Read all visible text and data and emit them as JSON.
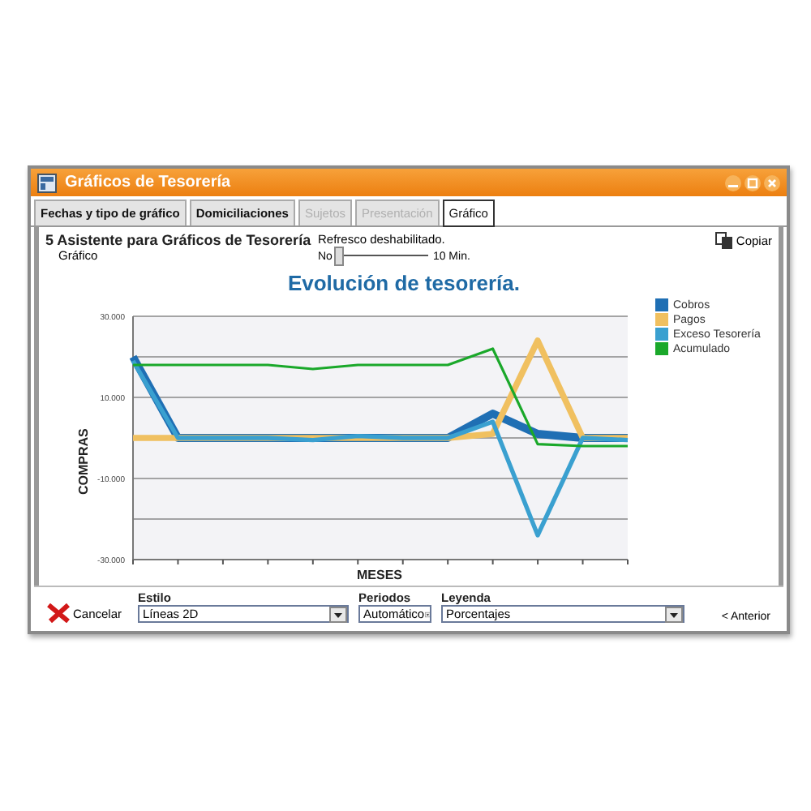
{
  "window": {
    "title": "Gráficos de Tesorería"
  },
  "tabs": [
    {
      "label": "Fechas y tipo de gráfico",
      "selected": false,
      "disabled": false
    },
    {
      "label": "Domiciliaciones",
      "selected": false,
      "disabled": false
    },
    {
      "label": "Sujetos",
      "selected": false,
      "disabled": true
    },
    {
      "label": "Presentación",
      "selected": false,
      "disabled": true
    },
    {
      "label": "Gráfico",
      "selected": true,
      "disabled": false
    }
  ],
  "header": {
    "step": "5",
    "title": "Asistente para Gráficos de Tesorería",
    "subtitle": "Gráfico"
  },
  "refresh": {
    "label": "Refresco deshabilitado.",
    "min_label": "No",
    "max_label": "10 Min.",
    "level": 0
  },
  "copy_button": "Copiar",
  "chart": {
    "chart_data": {
      "type": "line",
      "title": "Evolución de tesorería.",
      "xlabel": "MESES",
      "ylabel": "COMPRAS",
      "ylim": [
        -30000,
        30000
      ],
      "yticks": [
        {
          "value": 30000,
          "label": "30.000"
        },
        {
          "value": 10000,
          "label": "10.000"
        },
        {
          "value": -10000,
          "label": "-10.000"
        },
        {
          "value": -30000,
          "label": "-30.000"
        }
      ],
      "series": [
        {
          "name": "Cobros",
          "color": "#1f6fb4",
          "values": [
            20000,
            0,
            0,
            0,
            0,
            0,
            0,
            0,
            6000,
            1000,
            0,
            0
          ]
        },
        {
          "name": "Pagos",
          "color": "#f0c060",
          "values": [
            0,
            0,
            0,
            0,
            0,
            0,
            0,
            0,
            1000,
            24000,
            0,
            0
          ]
        },
        {
          "name": "Exceso Tesorería",
          "color": "#3aa0d0",
          "values": [
            19000,
            0,
            0,
            0,
            -500,
            500,
            0,
            0,
            4000,
            -24000,
            0,
            -500
          ]
        },
        {
          "name": "Acumulado",
          "color": "#1aa82a",
          "values": [
            18000,
            18000,
            18000,
            18000,
            17000,
            18000,
            18000,
            18000,
            22000,
            -1500,
            -2000,
            -2000
          ]
        }
      ]
    }
  },
  "controls": [
    {
      "label": "Estilo",
      "value": "Líneas 2D"
    },
    {
      "label": "Periodos",
      "value": "Automático"
    },
    {
      "label": "Leyenda",
      "value": "Porcentajes"
    }
  ],
  "cancel_button": "Cancelar",
  "back_button": "< Anterior"
}
